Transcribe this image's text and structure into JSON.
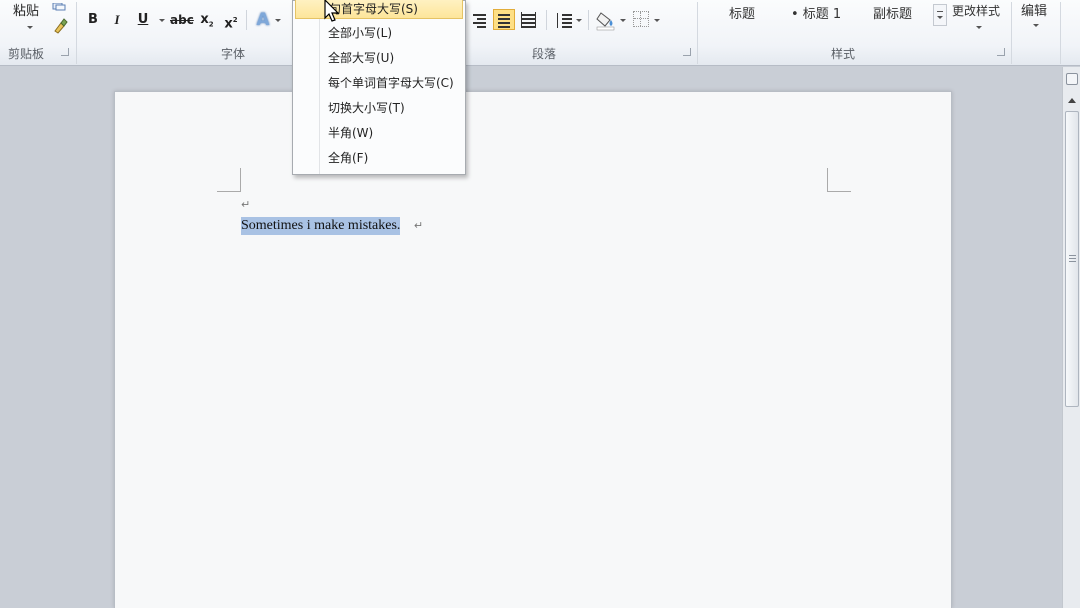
{
  "ribbon": {
    "clipboard": {
      "paste_label": "粘贴",
      "group_label": "剪贴板"
    },
    "font": {
      "group_label": "字体",
      "bold": "B",
      "italic": "I",
      "underline": "U",
      "strike": "abc",
      "subscript": "x",
      "superscript": "x",
      "text_effect": "A"
    },
    "paragraph": {
      "group_label": "段落"
    },
    "styles": {
      "group_label": "样式",
      "items": [
        "标题",
        "• 标题 1",
        "副标题"
      ],
      "change_styles": "更改样式"
    },
    "editing": {
      "label": "编辑"
    }
  },
  "case_menu": {
    "items": [
      {
        "label": "句首字母大写(S)",
        "highlighted": true
      },
      {
        "label": "全部小写(L)",
        "highlighted": false
      },
      {
        "label": "全部大写(U)",
        "highlighted": false
      },
      {
        "label": "每个单词首字母大写(C)",
        "highlighted": false
      },
      {
        "label": "切换大小写(T)",
        "highlighted": false
      },
      {
        "label": "半角(W)",
        "highlighted": false
      },
      {
        "label": "全角(F)",
        "highlighted": false
      }
    ]
  },
  "document": {
    "selected_text": "Sometimes i make mistakes.",
    "paragraph_mark": "↵"
  },
  "colors": {
    "selection": "#a9c2e4",
    "menu_highlight": "#fde59a",
    "active_button": "#fddf85"
  }
}
